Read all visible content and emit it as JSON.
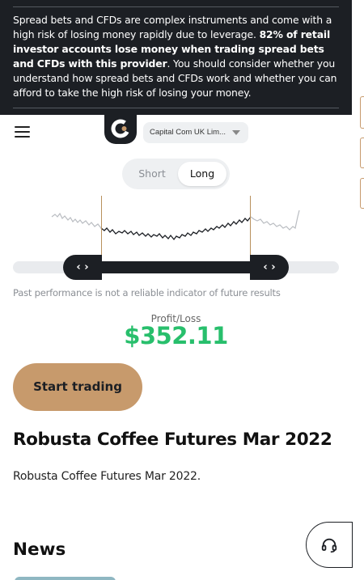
{
  "risk_warning": {
    "intro": "Spread bets and CFDs are complex instruments and come with a high risk of losing money rapidly due to leverage. ",
    "bold": "82% of retail investor accounts lose money when trading spread bets and CFDs with this provider",
    "outro": ". You should consider whether you understand how spread bets and CFDs work and whether you can afford to take the high risk of losing your money."
  },
  "header": {
    "menu_icon": "hamburger-menu-icon",
    "logo_icon": "capital-com-logo-icon",
    "entity_select": "Capital Com UK Lim..."
  },
  "direction_toggle": {
    "short_label": "Short",
    "long_label": "Long",
    "selected": "Long"
  },
  "range_slider": {
    "left_handle": "‹ ›",
    "right_handle": "‹ ›"
  },
  "disclaimer": "Past performance is not a reliable indicator of future results",
  "profit_loss": {
    "label": "Profit/Loss",
    "value": "$352.11",
    "color": "#28bf6c"
  },
  "cta": {
    "start_trading": "Start trading",
    "color": "#c79a6c"
  },
  "instrument": {
    "title": "Robusta Coffee Futures Mar 2022",
    "description": "Robusta Coffee Futures Mar 2022."
  },
  "news": {
    "heading": "News"
  },
  "support": {
    "icon": "headset-support-icon"
  },
  "colors": {
    "dark": "#1c1f24",
    "accent": "#c79a6c",
    "positive": "#28bf6c"
  }
}
